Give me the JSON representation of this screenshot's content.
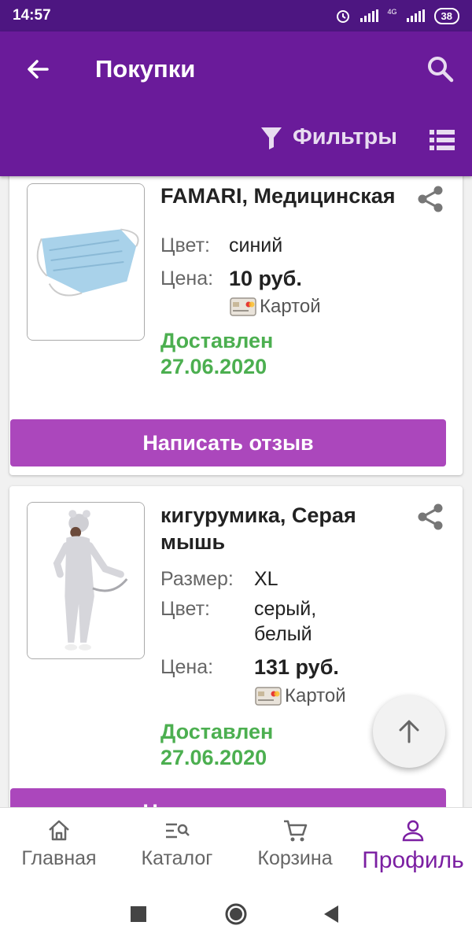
{
  "status_bar": {
    "time": "14:57",
    "network": "4G",
    "battery": "38"
  },
  "app_bar": {
    "title": "Покупки",
    "filters_label": "Фильтры"
  },
  "orders": [
    {
      "name": "FAMARI, Медицинская",
      "details": [
        {
          "label": "Цвет:",
          "value": "синий"
        },
        {
          "label": "Цена:",
          "value": "10 руб."
        }
      ],
      "payment": "Картой",
      "status_line1": "Доставлен",
      "status_line2": "27.06.2020",
      "review_button": "Написать отзыв"
    },
    {
      "name": "кигурумика, Серая мышь",
      "details": [
        {
          "label": "Размер:",
          "value": "XL"
        },
        {
          "label": "Цвет:",
          "value": "серый, белый"
        },
        {
          "label": "Цена:",
          "value": "131 руб."
        }
      ],
      "payment": "Картой",
      "status_line1": "Доставлен",
      "status_line2": "27.06.2020",
      "review_button": "Написать отзыв"
    }
  ],
  "bottom_nav": [
    {
      "label": "Главная",
      "icon": "home-icon",
      "active": false
    },
    {
      "label": "Каталог",
      "icon": "catalog-icon",
      "active": false
    },
    {
      "label": "Корзина",
      "icon": "cart-icon",
      "active": false
    },
    {
      "label": "Профиль",
      "icon": "profile-icon",
      "active": true
    }
  ],
  "colors": {
    "app_bar": "#6a1b9a",
    "status_bar": "#4d1681",
    "accent_button": "#ab47bc",
    "delivered": "#4caf50",
    "active_nav": "#7b1fa2"
  }
}
